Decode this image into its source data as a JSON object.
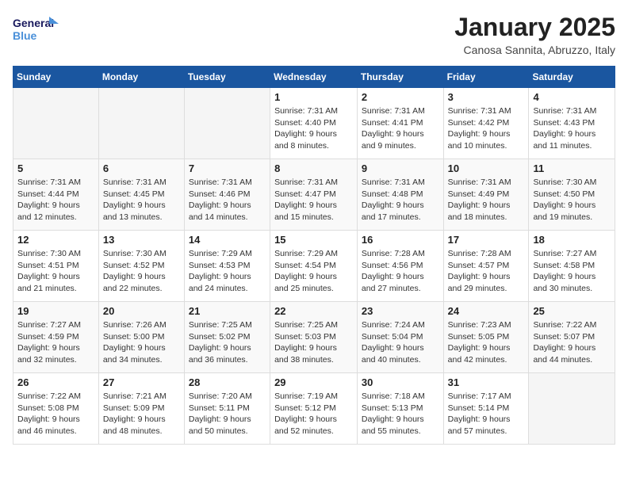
{
  "header": {
    "logo_line1": "General",
    "logo_line2": "Blue",
    "month": "January 2025",
    "location": "Canosa Sannita, Abruzzo, Italy"
  },
  "weekdays": [
    "Sunday",
    "Monday",
    "Tuesday",
    "Wednesday",
    "Thursday",
    "Friday",
    "Saturday"
  ],
  "weeks": [
    [
      {
        "day": "",
        "info": ""
      },
      {
        "day": "",
        "info": ""
      },
      {
        "day": "",
        "info": ""
      },
      {
        "day": "1",
        "info": "Sunrise: 7:31 AM\nSunset: 4:40 PM\nDaylight: 9 hours and 8 minutes."
      },
      {
        "day": "2",
        "info": "Sunrise: 7:31 AM\nSunset: 4:41 PM\nDaylight: 9 hours and 9 minutes."
      },
      {
        "day": "3",
        "info": "Sunrise: 7:31 AM\nSunset: 4:42 PM\nDaylight: 9 hours and 10 minutes."
      },
      {
        "day": "4",
        "info": "Sunrise: 7:31 AM\nSunset: 4:43 PM\nDaylight: 9 hours and 11 minutes."
      }
    ],
    [
      {
        "day": "5",
        "info": "Sunrise: 7:31 AM\nSunset: 4:44 PM\nDaylight: 9 hours and 12 minutes."
      },
      {
        "day": "6",
        "info": "Sunrise: 7:31 AM\nSunset: 4:45 PM\nDaylight: 9 hours and 13 minutes."
      },
      {
        "day": "7",
        "info": "Sunrise: 7:31 AM\nSunset: 4:46 PM\nDaylight: 9 hours and 14 minutes."
      },
      {
        "day": "8",
        "info": "Sunrise: 7:31 AM\nSunset: 4:47 PM\nDaylight: 9 hours and 15 minutes."
      },
      {
        "day": "9",
        "info": "Sunrise: 7:31 AM\nSunset: 4:48 PM\nDaylight: 9 hours and 17 minutes."
      },
      {
        "day": "10",
        "info": "Sunrise: 7:31 AM\nSunset: 4:49 PM\nDaylight: 9 hours and 18 minutes."
      },
      {
        "day": "11",
        "info": "Sunrise: 7:30 AM\nSunset: 4:50 PM\nDaylight: 9 hours and 19 minutes."
      }
    ],
    [
      {
        "day": "12",
        "info": "Sunrise: 7:30 AM\nSunset: 4:51 PM\nDaylight: 9 hours and 21 minutes."
      },
      {
        "day": "13",
        "info": "Sunrise: 7:30 AM\nSunset: 4:52 PM\nDaylight: 9 hours and 22 minutes."
      },
      {
        "day": "14",
        "info": "Sunrise: 7:29 AM\nSunset: 4:53 PM\nDaylight: 9 hours and 24 minutes."
      },
      {
        "day": "15",
        "info": "Sunrise: 7:29 AM\nSunset: 4:54 PM\nDaylight: 9 hours and 25 minutes."
      },
      {
        "day": "16",
        "info": "Sunrise: 7:28 AM\nSunset: 4:56 PM\nDaylight: 9 hours and 27 minutes."
      },
      {
        "day": "17",
        "info": "Sunrise: 7:28 AM\nSunset: 4:57 PM\nDaylight: 9 hours and 29 minutes."
      },
      {
        "day": "18",
        "info": "Sunrise: 7:27 AM\nSunset: 4:58 PM\nDaylight: 9 hours and 30 minutes."
      }
    ],
    [
      {
        "day": "19",
        "info": "Sunrise: 7:27 AM\nSunset: 4:59 PM\nDaylight: 9 hours and 32 minutes."
      },
      {
        "day": "20",
        "info": "Sunrise: 7:26 AM\nSunset: 5:00 PM\nDaylight: 9 hours and 34 minutes."
      },
      {
        "day": "21",
        "info": "Sunrise: 7:25 AM\nSunset: 5:02 PM\nDaylight: 9 hours and 36 minutes."
      },
      {
        "day": "22",
        "info": "Sunrise: 7:25 AM\nSunset: 5:03 PM\nDaylight: 9 hours and 38 minutes."
      },
      {
        "day": "23",
        "info": "Sunrise: 7:24 AM\nSunset: 5:04 PM\nDaylight: 9 hours and 40 minutes."
      },
      {
        "day": "24",
        "info": "Sunrise: 7:23 AM\nSunset: 5:05 PM\nDaylight: 9 hours and 42 minutes."
      },
      {
        "day": "25",
        "info": "Sunrise: 7:22 AM\nSunset: 5:07 PM\nDaylight: 9 hours and 44 minutes."
      }
    ],
    [
      {
        "day": "26",
        "info": "Sunrise: 7:22 AM\nSunset: 5:08 PM\nDaylight: 9 hours and 46 minutes."
      },
      {
        "day": "27",
        "info": "Sunrise: 7:21 AM\nSunset: 5:09 PM\nDaylight: 9 hours and 48 minutes."
      },
      {
        "day": "28",
        "info": "Sunrise: 7:20 AM\nSunset: 5:11 PM\nDaylight: 9 hours and 50 minutes."
      },
      {
        "day": "29",
        "info": "Sunrise: 7:19 AM\nSunset: 5:12 PM\nDaylight: 9 hours and 52 minutes."
      },
      {
        "day": "30",
        "info": "Sunrise: 7:18 AM\nSunset: 5:13 PM\nDaylight: 9 hours and 55 minutes."
      },
      {
        "day": "31",
        "info": "Sunrise: 7:17 AM\nSunset: 5:14 PM\nDaylight: 9 hours and 57 minutes."
      },
      {
        "day": "",
        "info": ""
      }
    ]
  ]
}
